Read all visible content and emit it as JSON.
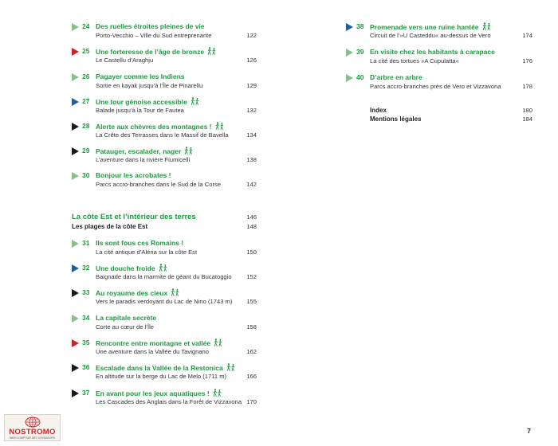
{
  "colors": {
    "green": "#1f9a3e",
    "triangle_green": "#8cc08a",
    "triangle_blue": "#1f5f9a",
    "triangle_red": "#c8242b",
    "triangle_black": "#1a1a1a"
  },
  "left_entries": [
    {
      "num": "24",
      "title": "Des ruelles étroites pleines de vie",
      "subtitle": "Porto-Vecchio – Ville du Sud entreprenante",
      "page": "122",
      "marker": "green",
      "walk": false
    },
    {
      "num": "25",
      "title": "Une forteresse de l’âge de bronze",
      "subtitle": "Le Castellu d’Araghju",
      "page": "126",
      "marker": "red",
      "walk": true
    },
    {
      "num": "26",
      "title": "Pagayer comme les Indiens",
      "subtitle": "Sortie en kayak jusqu’à l’Île de Pinarellu",
      "page": "129",
      "marker": "green",
      "walk": false
    },
    {
      "num": "27",
      "title": "Une tour génoise accessible",
      "subtitle": "Balade jusqu’à la Tour de Fautea",
      "page": "132",
      "marker": "blue",
      "walk": true
    },
    {
      "num": "28",
      "title": "Alerte aux chèvres des montagnes !",
      "subtitle": "La Crête des Terrasses dans le Massif de Bavella",
      "page": "134",
      "marker": "black",
      "walk": true
    },
    {
      "num": "29",
      "title": "Patauger, escalader, nager",
      "subtitle": "L’aventure dans la rivière Fiumicelli",
      "page": "138",
      "marker": "black",
      "walk": true
    },
    {
      "num": "30",
      "title": "Bonjour les acrobates !",
      "subtitle": "Parcs accro-branches dans le Sud de la Corse",
      "page": "142",
      "marker": "green",
      "walk": false
    }
  ],
  "section": {
    "title": "La côte Est et l’intérieur des terres",
    "page": "146",
    "subtitle": "Les plages de la côte Est",
    "sub_page": "148"
  },
  "left_entries_2": [
    {
      "num": "31",
      "title": "Ils sont fous ces Romains !",
      "subtitle": "La cité antique d’Aléria sur la côte Est",
      "page": "150",
      "marker": "green",
      "walk": false
    },
    {
      "num": "32",
      "title": "Une douche froide",
      "subtitle": "Baignade dans la marmite de géant du Bucatoggio",
      "page": "152",
      "marker": "blue",
      "walk": true
    },
    {
      "num": "33",
      "title": "Au royaume des cieux",
      "subtitle": "Vers le paradis verdoyant du Lac de Nino (1743 m)",
      "page": "155",
      "marker": "black",
      "walk": true
    },
    {
      "num": "34",
      "title": "La capitale secrète",
      "subtitle": "Corte au cœur de l’Île",
      "page": "158",
      "marker": "green",
      "walk": false
    },
    {
      "num": "35",
      "title": "Rencontre entre montagne et vallée",
      "subtitle": "Une aventure dans la Vallée du Tavignano",
      "page": "162",
      "marker": "red",
      "walk": true
    },
    {
      "num": "36",
      "title": "Escalade dans la Vallée de la Restonica",
      "subtitle": "En altitude sur la berge du Lac de Melo (1711 m)",
      "page": "166",
      "marker": "black",
      "walk": true
    },
    {
      "num": "37",
      "title": "En avant pour les jeux aquatiques !",
      "subtitle": "Les Cascades des Anglais dans la Forêt de Vizzavona",
      "page": "170",
      "marker": "black",
      "walk": true
    }
  ],
  "right_entries": [
    {
      "num": "38",
      "title": "Promenade vers une ruine hantée",
      "subtitle": "Circuit de l’»U Casteddu« au-dessus de Vero",
      "page": "174",
      "marker": "blue",
      "walk": true
    },
    {
      "num": "39",
      "title": "En visite chez les habitants à carapace",
      "subtitle": "La cité des tortues »A Cupulatta«",
      "page": "176",
      "marker": "green",
      "walk": false
    },
    {
      "num": "40",
      "title": "D’arbre en arbre",
      "subtitle": "Parcs accro-branches près de Vero et Vizzavona",
      "page": "178",
      "marker": "green",
      "walk": false
    }
  ],
  "extras": [
    {
      "label": "Index",
      "page": "180"
    },
    {
      "label": "Mentions légales",
      "page": "184"
    }
  ],
  "page_number": "7",
  "logo": {
    "brand": "NOSTROMO",
    "tagline": "WEB COMPTOIR DES VOYAGEURS"
  }
}
